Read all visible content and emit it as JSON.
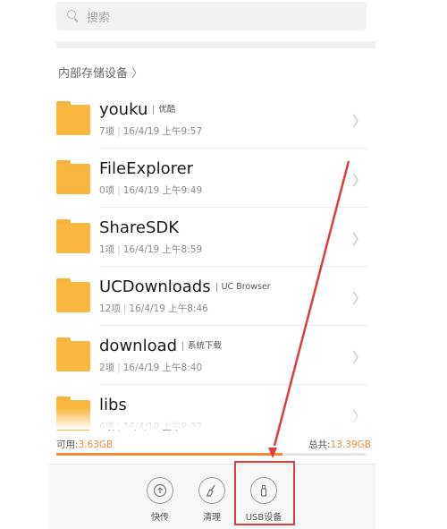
{
  "search": {
    "placeholder": "搜索"
  },
  "breadcrumb": {
    "label": "内部存储设备",
    "chevron": "〉"
  },
  "files": [
    {
      "name": "youku",
      "tag": "优酷",
      "count": "7项",
      "datetime": "16/4/19 上午9:57"
    },
    {
      "name": "FileExplorer",
      "tag": "",
      "count": "0项",
      "datetime": "16/4/19 上午9:49"
    },
    {
      "name": "ShareSDK",
      "tag": "",
      "count": "1项",
      "datetime": "16/4/19 上午8:59"
    },
    {
      "name": "UCDownloads",
      "tag": "UC Browser",
      "count": "12项",
      "datetime": "16/4/19 上午8:46"
    },
    {
      "name": "download",
      "tag": "系统下载",
      "count": "2项",
      "datetime": "16/4/19 上午8:40"
    },
    {
      "name": "libs",
      "tag": "",
      "count": "6项",
      "datetime": "16/4/19 上午8:32"
    }
  ],
  "storage": {
    "available_label": "可用:",
    "available_value": "3.63GB",
    "total_label": "总共:",
    "total_value": "13.39GB",
    "used_fraction": 0.73
  },
  "toolbar": {
    "send_label": "快传",
    "clean_label": "清理",
    "usb_label": "USB设备"
  },
  "colors": {
    "accent": "#f4893b",
    "folder": "#f9b73f",
    "annotation": "#e23b3b"
  },
  "icons": {
    "search": "search-icon",
    "folder": "folder-icon",
    "chevron": "chevron-right-icon",
    "send": "upload-icon",
    "clean": "broom-icon",
    "usb": "usb-drive-icon"
  }
}
